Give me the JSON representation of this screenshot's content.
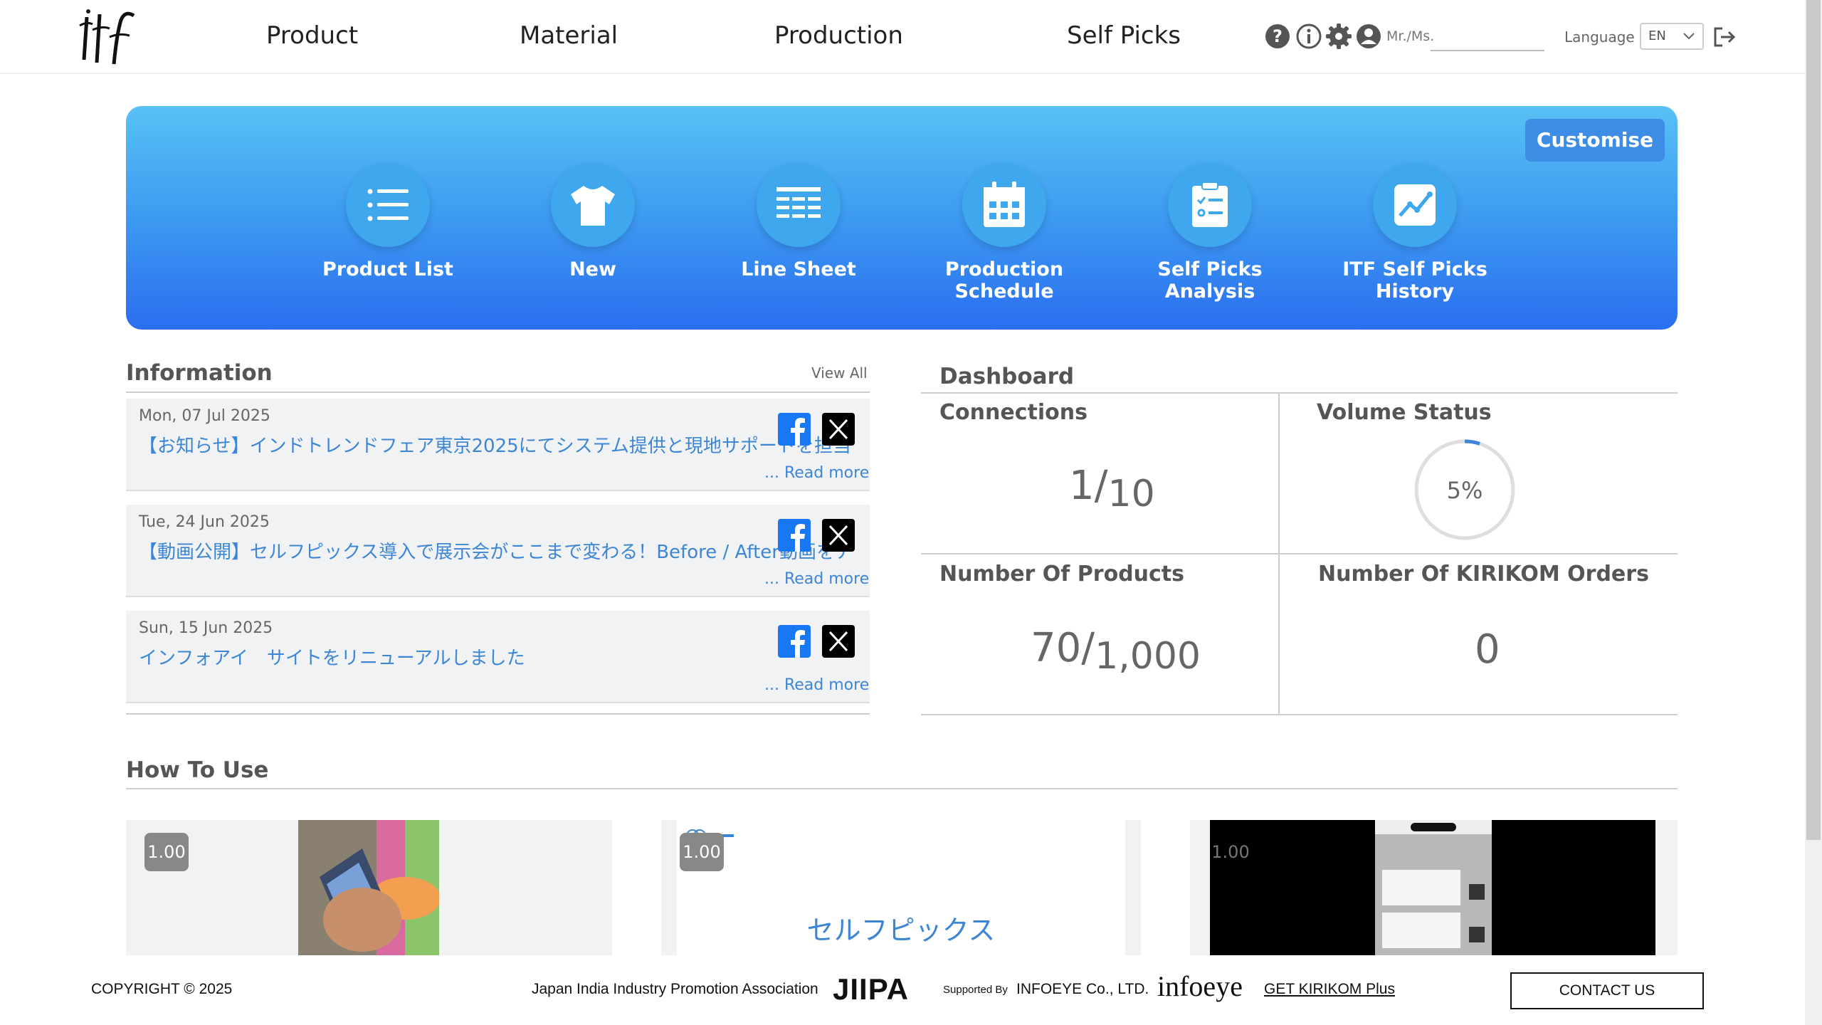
{
  "header": {
    "logo_text": "itf",
    "nav": [
      "Product",
      "Material",
      "Production",
      "Self Picks"
    ],
    "user_label": "Mr./Ms.",
    "user_value": "",
    "language_label": "Language",
    "language_value": "EN"
  },
  "banner": {
    "customise_label": "Customise",
    "shortcuts": [
      {
        "label": "Product List",
        "icon": "list-icon"
      },
      {
        "label": "New",
        "icon": "tshirt-icon"
      },
      {
        "label": "Line Sheet",
        "icon": "line-sheet-icon"
      },
      {
        "label": "Production Schedule",
        "icon": "calendar-icon"
      },
      {
        "label": "Self Picks Analysis",
        "icon": "checklist-icon"
      },
      {
        "label": "ITF Self Picks History",
        "icon": "chart-icon"
      }
    ]
  },
  "information": {
    "title": "Information",
    "view_all": "View All",
    "read_more": "... Read more",
    "items": [
      {
        "date": "Mon, 07 Jul 2025",
        "title": "【お知らせ】インドトレンドフェア東京2025にてシステム提供と現地サポートを担当いた"
      },
      {
        "date": "Tue, 24 Jun 2025",
        "title": "【動画公開】セルフピックス導入で展示会がここまで変わる！Before / After動画をアップ"
      },
      {
        "date": "Sun, 15 Jun 2025",
        "title": "インフォアイ　サイトをリニューアルしました"
      }
    ]
  },
  "dashboard": {
    "title": "Dashboard",
    "connections": {
      "label": "Connections",
      "value": "1",
      "max": "10"
    },
    "volume": {
      "label": "Volume Status",
      "percent_text": "5%",
      "percent": 5
    },
    "products": {
      "label": "Number Of Products",
      "value": "70",
      "max": "1,000"
    },
    "orders": {
      "label": "Number Of KIRIKOM Orders",
      "value": "0"
    }
  },
  "how_to_use": {
    "title": "How To Use",
    "videos": [
      {
        "speed": "1.00"
      },
      {
        "speed": "1.00",
        "caption": "セルフピックス"
      },
      {
        "speed": "1.00"
      }
    ]
  },
  "footer": {
    "copyright": "COPYRIGHT © 2025",
    "association": "Japan India Industry Promotion Association",
    "jiipa": "JIIPA",
    "supported_by": "Supported By",
    "company": "INFOEYE Co., LTD.",
    "infoeye_logo": "infoeye",
    "get_kirikom": "GET KIRIKOM Plus",
    "contact": "CONTACT US"
  },
  "colors": {
    "accent": "#3d86d6",
    "banner_top": "#58c1f4",
    "banner_bottom": "#2a6ef0"
  }
}
